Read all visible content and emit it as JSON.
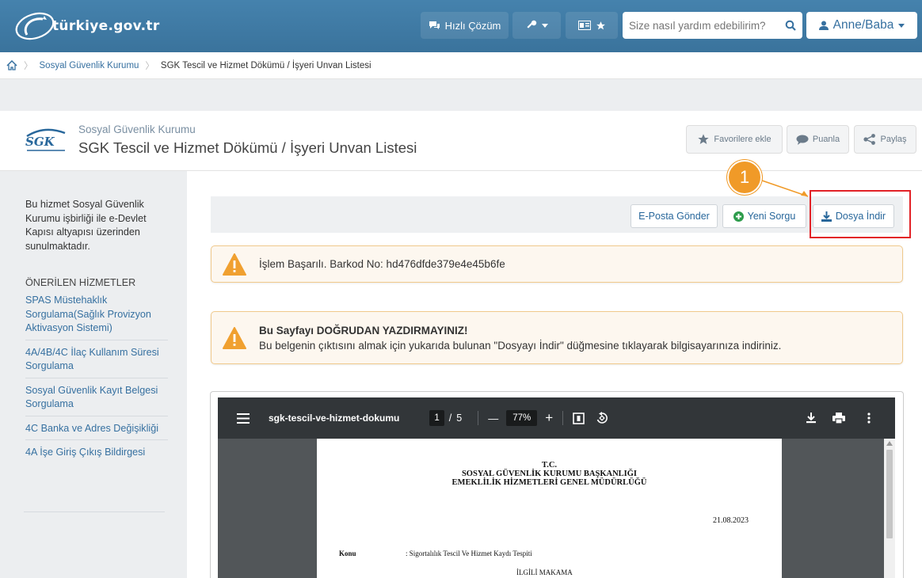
{
  "portal": {
    "logo_text": "türkiye.gov.tr",
    "quick_solution": "Hızlı Çözüm",
    "search_placeholder": "Size nasıl yardım edebilirim?",
    "user_label": "Anne/Baba"
  },
  "breadcrumb": {
    "home_icon": "home-icon",
    "items": [
      "Sosyal Güvenlik Kurumu",
      "SGK Tescil ve Hizmet Dökümü / İşyeri Unvan Listesi"
    ]
  },
  "header": {
    "logo_text": "SGK",
    "institution": "Sosyal Güvenlik Kurumu",
    "title": "SGK Tescil ve Hizmet Dökümü / İşyeri Unvan Listesi",
    "favorite_label": "Favorilere ekle",
    "rate_label": "Puanla",
    "share_label": "Paylaş"
  },
  "sidebar": {
    "description": "Bu hizmet Sosyal Güvenlik Kurumu işbirliği ile e-Devlet Kapısı altyapısı üzerinden sunulmaktadır.",
    "heading": "ÖNERİLEN HİZMETLER",
    "items": [
      {
        "label": "SPAS Müstehaklık Sorgulama(Sağlık Provizyon Aktivasyon Sistemi)"
      },
      {
        "label": "4A/4B/4C İlaç Kullanım Süresi Sorgulama"
      },
      {
        "label": "Sosyal Güvenlik Kayıt Belgesi Sorgulama"
      },
      {
        "label": "4C Banka ve Adres Değişikliği"
      },
      {
        "label": "4A İşe Giriş Çıkış Bildirgesi"
      }
    ]
  },
  "actions": {
    "email_label": "E-Posta Gönder",
    "new_query_label": "Yeni Sorgu",
    "download_label": "Dosya İndir"
  },
  "callout": {
    "number": "1"
  },
  "alerts": {
    "success_text": "İşlem Başarılı. Barkod No: hd476dfde379e4e45b6fe",
    "warning_title": "Bu Sayfayı DOĞRUDAN YAZDIRMAYINIZ!",
    "warning_text": "Bu belgenin çıktısını almak için yukarıda bulunan \"Dosyayı İndir\" düğmesine tıklayarak bilgisayarınıza indiriniz."
  },
  "pdf_viewer": {
    "file_name": "sgk-tescil-ve-hizmet-dokumu",
    "current_page": "1",
    "page_separator": "/",
    "total_pages": "5",
    "zoom": "77%",
    "minus": "—",
    "plus": "+"
  },
  "document": {
    "line1": "T.C.",
    "line2": "SOSYAL GÜVENLİK KURUMU BAŞKANLIĞI",
    "line3": "EMEKLİLİK HİZMETLERİ GENEL MÜDÜRLÜĞÜ",
    "date": "21.08.2023",
    "subject_label": "Konu",
    "subject_value": ": Sigortalılık Tescil Ve Hizmet Kaydı Tespiti",
    "addressee": "İLGİLİ MAKAMA"
  },
  "colors": {
    "navbar": "#3f7ba6",
    "link": "#3670a0",
    "highlight": "#e22227",
    "callout": "#f09a28",
    "warning": "#f0a030",
    "pdf_toolbar": "#323639"
  }
}
